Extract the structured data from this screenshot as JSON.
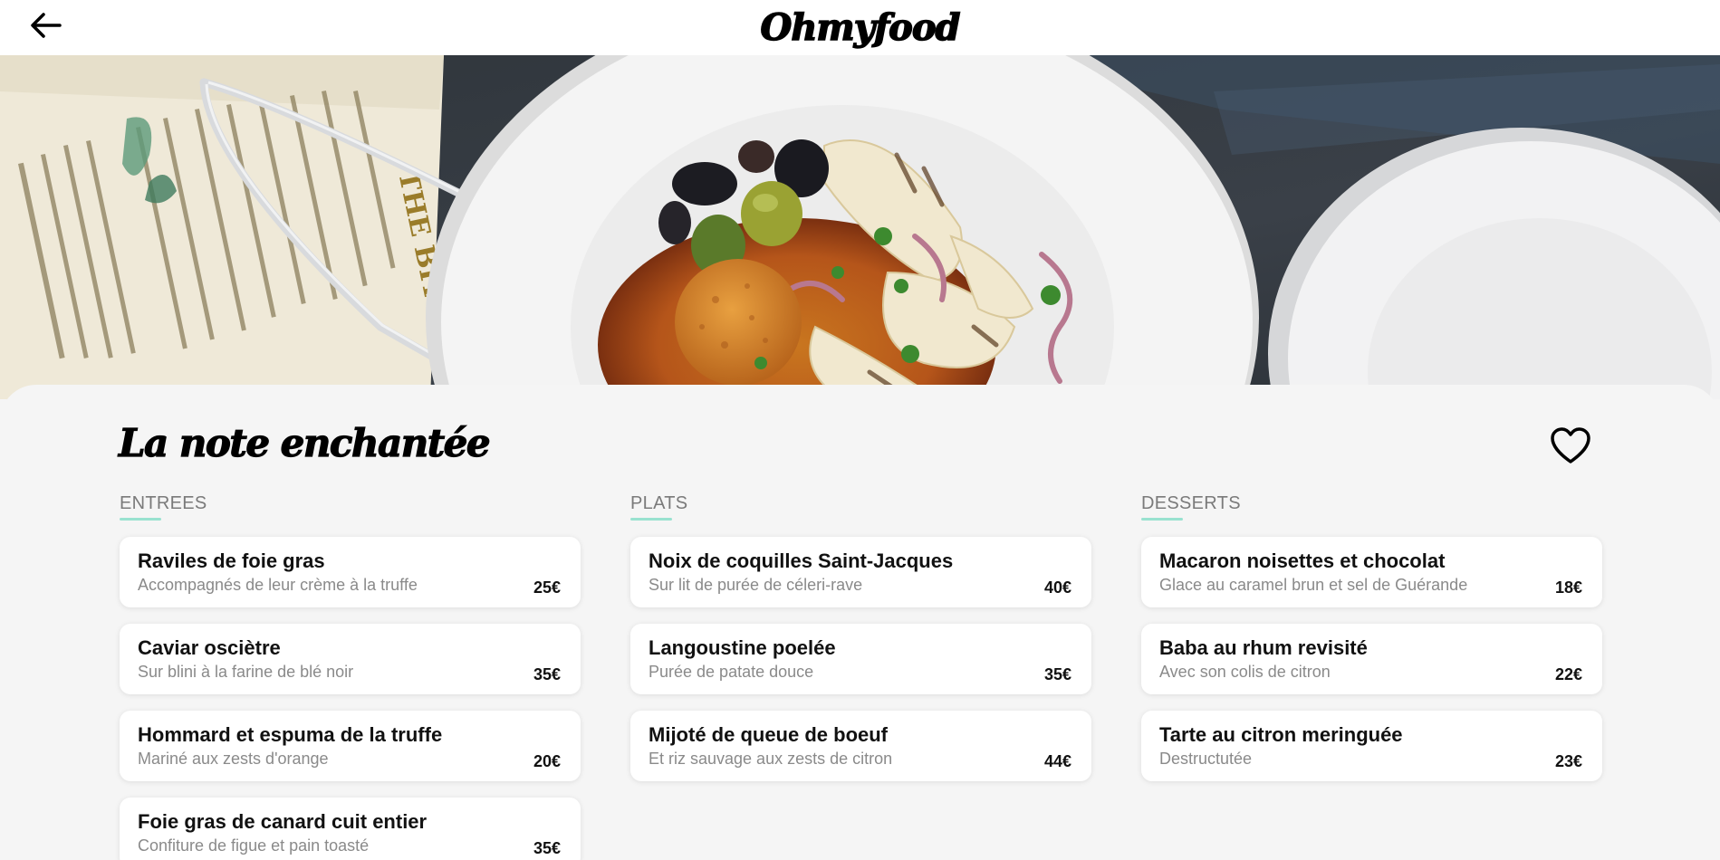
{
  "header": {
    "logo": "Ohmyfood",
    "back_icon": "arrow-left-icon"
  },
  "hero": {
    "image": "restaurant-hero-photo",
    "menu_card_text": "THE BITE"
  },
  "restaurant": {
    "name": "La note enchantée",
    "like_icon": "heart-icon"
  },
  "colors": {
    "accent": "#99e2d0",
    "panel_bg": "#f5f5f5",
    "card_bg": "#ffffff"
  },
  "sections": [
    {
      "title": "ENTREES",
      "dishes": [
        {
          "name": "Raviles de foie gras",
          "description": "Accompagnés de leur crème à la truffe",
          "price": "25€"
        },
        {
          "name": "Caviar osciètre",
          "description": "Sur blini à la farine de blé noir",
          "price": "35€"
        },
        {
          "name": "Hommard et espuma de la truffe",
          "description": "Mariné aux zests d'orange",
          "price": "20€"
        },
        {
          "name": "Foie gras de canard cuit entier",
          "description": "Confiture de figue et pain toasté",
          "price": "35€"
        }
      ]
    },
    {
      "title": "PLATS",
      "dishes": [
        {
          "name": "Noix de coquilles Saint-Jacques",
          "description": "Sur lit de purée de céleri-rave",
          "price": "40€"
        },
        {
          "name": "Langoustine poelée",
          "description": "Purée de patate douce",
          "price": "35€"
        },
        {
          "name": "Mijoté de queue de boeuf",
          "description": "Et riz sauvage aux zests de citron",
          "price": "44€"
        }
      ]
    },
    {
      "title": "DESSERTS",
      "dishes": [
        {
          "name": "Macaron noisettes et chocolat",
          "description": "Glace au caramel brun et sel de Guérande",
          "price": "18€"
        },
        {
          "name": "Baba au rhum revisité",
          "description": "Avec son colis de citron",
          "price": "22€"
        },
        {
          "name": "Tarte au citron meringuée",
          "description": "Destructutée",
          "price": "23€"
        }
      ]
    }
  ]
}
